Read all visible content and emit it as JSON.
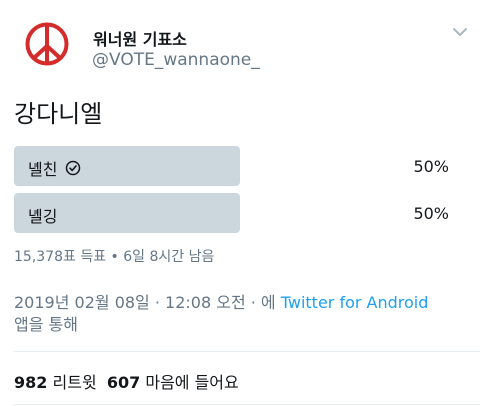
{
  "author": {
    "display_name": "워너원 기표소",
    "handle": "@VOTE_wannaone_",
    "avatar_icon": "peace-sign-icon"
  },
  "tweet": {
    "text": "강다니엘"
  },
  "poll": {
    "options": [
      {
        "label": "녤친",
        "percent": "50%",
        "share": 0.5,
        "selected": true
      },
      {
        "label": "녤깅",
        "percent": "50%",
        "share": 0.5,
        "selected": false
      }
    ],
    "meta": "15,378표 득표 • 6일 8시간 남음"
  },
  "timestamp": {
    "date": "2019년 02월 08일 · 12:08 오전 · 에",
    "source": "Twitter for Android",
    "suffix": "앱을 통해"
  },
  "stats": {
    "retweets_count": "982",
    "retweets_label": "리트윗",
    "likes_count": "607",
    "likes_label": "마음에 들어요"
  },
  "colors": {
    "accent": "#1da1f2",
    "poll_bar": "#ccd6dd",
    "secondary_text": "#657786",
    "avatar_red": "#d42b2b"
  }
}
